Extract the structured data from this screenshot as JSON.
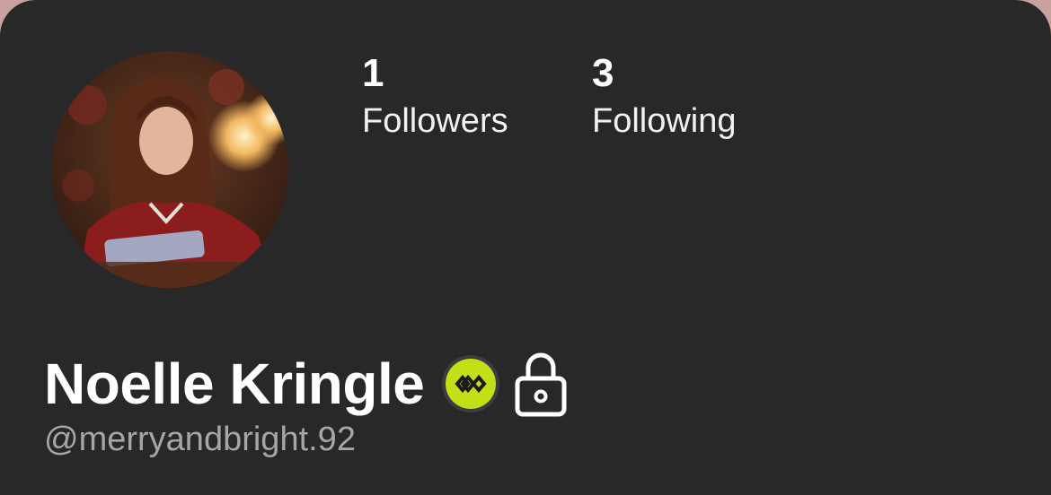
{
  "profile": {
    "display_name": "Noelle Kringle",
    "handle": "@merryandbright.92",
    "avatar": "profile-photo"
  },
  "stats": {
    "followers": {
      "count": "1",
      "label": "Followers"
    },
    "following": {
      "count": "3",
      "label": "Following"
    }
  },
  "icons": {
    "badge": "infinity-badge-icon",
    "lock": "lock-icon"
  },
  "colors": {
    "background": "#282828",
    "badge_accent": "#c3e016",
    "handle_text": "#a6a6a6"
  }
}
